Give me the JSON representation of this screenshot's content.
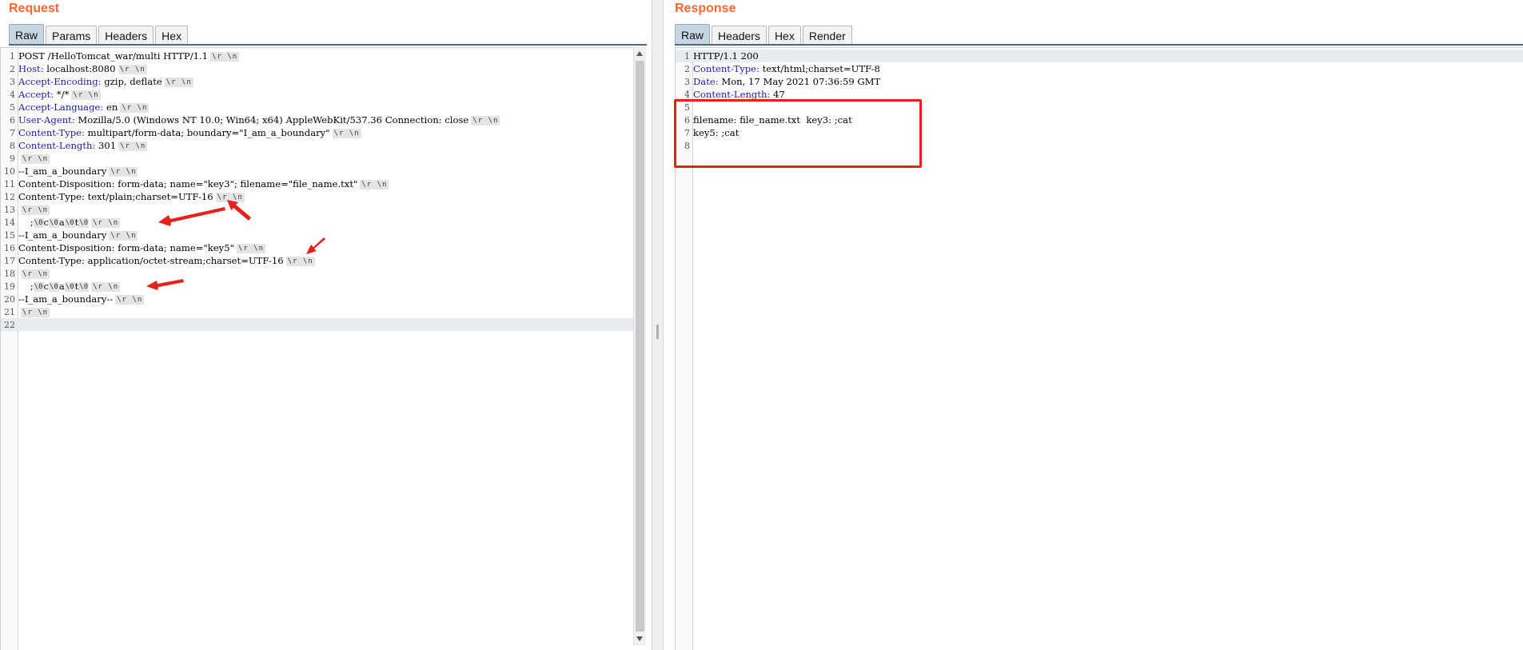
{
  "request": {
    "title": "Request",
    "tabs": [
      {
        "label": "Raw",
        "active": true
      },
      {
        "label": "Params",
        "active": false
      },
      {
        "label": "Headers",
        "active": false
      },
      {
        "label": "Hex",
        "active": false
      }
    ],
    "lines": [
      {
        "n": "1",
        "key": "",
        "text": "POST /HelloTomcat_war/multi HTTP/1.1",
        "crlf": true
      },
      {
        "n": "2",
        "key": "Host:",
        "text": " localhost:8080",
        "crlf": true
      },
      {
        "n": "3",
        "key": "Accept-Encoding:",
        "text": " gzip, deflate",
        "crlf": true
      },
      {
        "n": "4",
        "key": "Accept:",
        "text": " */*",
        "crlf": true
      },
      {
        "n": "5",
        "key": "Accept-Language:",
        "text": " en",
        "crlf": true
      },
      {
        "n": "6",
        "key": "User-Agent:",
        "text": " Mozilla/5.0 (Windows NT 10.0; Win64; x64) AppleWebKit/537.36 Connection: close",
        "crlf": true
      },
      {
        "n": "7",
        "key": "Content-Type:",
        "text": " multipart/form-data; boundary=\"I_am_a_boundary\"",
        "crlf": true
      },
      {
        "n": "8",
        "key": "Content-Length:",
        "text": " 301",
        "crlf": true
      },
      {
        "n": "9",
        "key": "",
        "text": "",
        "crlf": true
      },
      {
        "n": "10",
        "key": "",
        "text": "--I_am_a_boundary",
        "crlf": true
      },
      {
        "n": "11",
        "key": "",
        "text": "Content-Disposition: form-data; name=\"key3\"; filename=\"file_name.txt\"",
        "crlf": true
      },
      {
        "n": "12",
        "key": "",
        "text": "Content-Type: text/plain;charset=UTF-16",
        "crlf": true
      },
      {
        "n": "13",
        "key": "",
        "text": "",
        "crlf": true
      },
      {
        "n": "14",
        "key": "",
        "text": "    ;",
        "special": [
          "\\0",
          "c",
          "\\0",
          "a",
          "\\0",
          "t",
          "\\0"
        ],
        "crlf": true
      },
      {
        "n": "15",
        "key": "",
        "text": "--I_am_a_boundary",
        "crlf": true
      },
      {
        "n": "16",
        "key": "",
        "text": "Content-Disposition: form-data; name=\"key5\"",
        "crlf": true
      },
      {
        "n": "17",
        "key": "",
        "text": "Content-Type: application/octet-stream;charset=UTF-16",
        "crlf": true
      },
      {
        "n": "18",
        "key": "",
        "text": "",
        "crlf": true
      },
      {
        "n": "19",
        "key": "",
        "text": "    ;",
        "special": [
          "\\0",
          "c",
          "\\0",
          "a",
          "\\0",
          "t",
          "\\0"
        ],
        "crlf": true
      },
      {
        "n": "20",
        "key": "",
        "text": "--I_am_a_boundary--",
        "crlf": true
      },
      {
        "n": "21",
        "key": "",
        "text": "",
        "crlf": true
      },
      {
        "n": "22",
        "key": "",
        "text": "",
        "crlf": false,
        "current": true
      }
    ],
    "crlf_label": "\\r \\n"
  },
  "response": {
    "title": "Response",
    "tabs": [
      {
        "label": "Raw",
        "active": true
      },
      {
        "label": "Headers",
        "active": false
      },
      {
        "label": "Hex",
        "active": false
      },
      {
        "label": "Render",
        "active": false
      }
    ],
    "lines": [
      {
        "n": "1",
        "key": "",
        "text": "HTTP/1.1 200",
        "current": true
      },
      {
        "n": "2",
        "key": "Content-Type:",
        "text": " text/html;charset=UTF-8"
      },
      {
        "n": "3",
        "key": "Date:",
        "text": " Mon, 17 May 2021 07:36:59 GMT"
      },
      {
        "n": "4",
        "key": "Content-Length:",
        "text": " 47"
      },
      {
        "n": "5",
        "key": "",
        "text": ""
      },
      {
        "n": "6",
        "key": "",
        "text": "filename: file_name.txt  key3: ;cat"
      },
      {
        "n": "7",
        "key": "",
        "text": "key5: ;cat"
      },
      {
        "n": "8",
        "key": "",
        "text": ""
      }
    ]
  },
  "annotation_color": "#e8201c"
}
